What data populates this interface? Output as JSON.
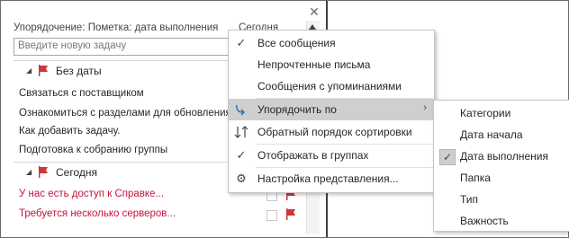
{
  "window": {
    "close_icon": "close-icon"
  },
  "sort_bar": {
    "label": "Упорядочение: Пометка: дата выполнения",
    "today": "Сегодня"
  },
  "new_task": {
    "placeholder": "Введите новую задачу"
  },
  "groups": [
    {
      "title": "Без даты",
      "tasks": [
        "Связаться с поставщиком",
        "Ознакомиться с разделами для обновления",
        "Как добавить задачу.",
        "Подготовка к собранию группы"
      ]
    },
    {
      "title": "Сегодня",
      "tasks": [
        "У нас есть доступ к Справке...",
        "Требуется несколько серверов..."
      ]
    }
  ],
  "menu": {
    "items": [
      {
        "label": "Все сообщения",
        "icon": "check-icon"
      },
      {
        "label": "Непрочтенные письма",
        "icon": ""
      },
      {
        "label": "Сообщения с упоминаниями",
        "icon": ""
      },
      {
        "label": "Упорядочить по",
        "icon": "arrange-arrow-icon",
        "has_submenu": true,
        "highlighted": true
      },
      {
        "label": "Обратный порядок сортировки",
        "icon": "sort-reverse-icon"
      },
      {
        "label": "Отображать в группах",
        "icon": "check-icon"
      },
      {
        "label": "Настройка представления...",
        "icon": "gear-icon"
      }
    ]
  },
  "submenu": {
    "items": [
      {
        "label": "Категории",
        "checked": false
      },
      {
        "label": "Дата начала",
        "checked": false
      },
      {
        "label": "Дата выполнения",
        "checked": true
      },
      {
        "label": "Папка",
        "checked": false
      },
      {
        "label": "Тип",
        "checked": false
      },
      {
        "label": "Важность",
        "checked": false
      }
    ]
  },
  "colors": {
    "flag": "#d13438",
    "overdue_text": "#c4123c",
    "menu_highlight": "#cfcfcf",
    "arrange_icon": "#2b6fb6"
  }
}
